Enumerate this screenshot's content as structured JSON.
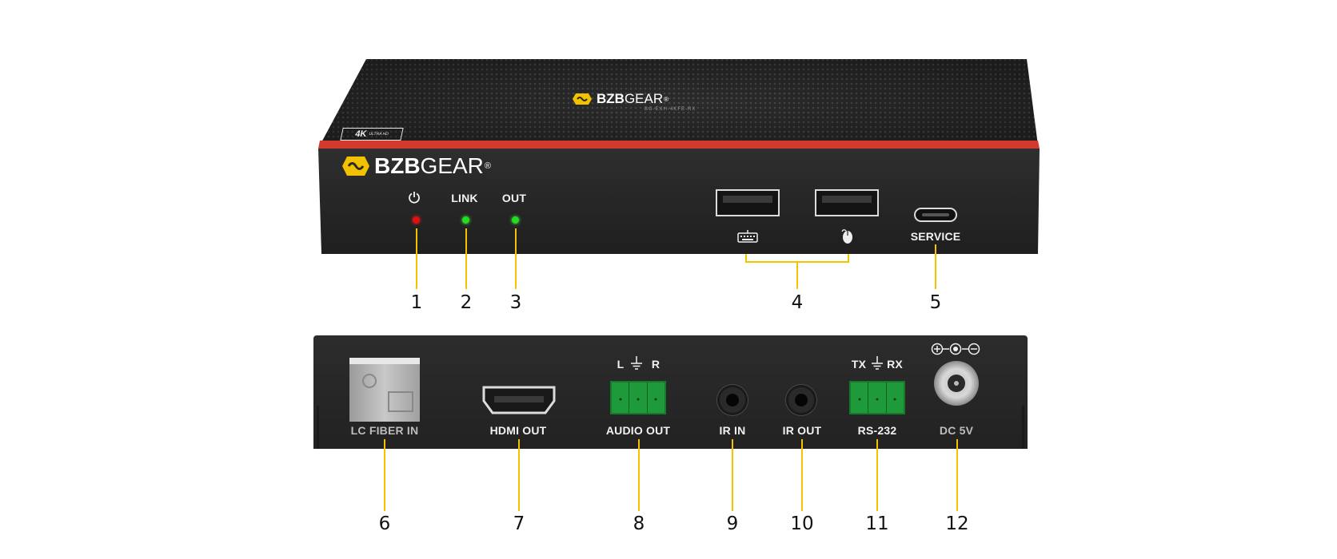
{
  "front_panel": {
    "top_brand": {
      "bold": "BZB",
      "light": "GEAR",
      "reg": "®"
    },
    "model": "BG-EXH-4KFE-RX",
    "badge": {
      "main": "4K",
      "sub": "ULTRA HD"
    },
    "face_brand": {
      "bold": "BZB",
      "light": "GEAR",
      "reg": "®"
    },
    "led_labels": {
      "link": "LINK",
      "out": "OUT"
    },
    "service_label": "SERVICE",
    "colors": {
      "power_led": "#e01010",
      "link_led": "#22dd22",
      "out_led": "#22dd22",
      "accent": "#d23a2e",
      "brand_icon": "#f2c200"
    }
  },
  "rear_panel": {
    "ports": [
      {
        "label": "LC FIBER IN"
      },
      {
        "label": "HDMI OUT"
      },
      {
        "label": "AUDIO OUT"
      },
      {
        "label": "IR IN"
      },
      {
        "label": "IR OUT"
      },
      {
        "label": "RS-232"
      },
      {
        "label": "DC 5V"
      }
    ],
    "audio_pins": {
      "left": "L",
      "right": "R"
    },
    "rs232_pins": {
      "left": "TX",
      "right": "RX"
    }
  },
  "callouts": [
    "1",
    "2",
    "3",
    "4",
    "5",
    "6",
    "7",
    "8",
    "9",
    "10",
    "11",
    "12"
  ]
}
